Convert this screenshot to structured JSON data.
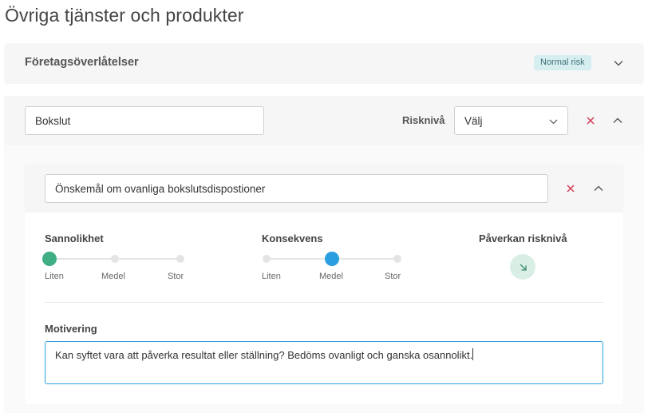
{
  "page": {
    "title": "Övriga tjänster och produkter"
  },
  "collapsed_card": {
    "title": "Företagsöverlåtelser",
    "badge": "Normal risk",
    "chevron_icon": "chevron-down-icon"
  },
  "expanded_card": {
    "name_value": "Bokslut",
    "risk_label": "Risknivå",
    "risk_select": {
      "selected": "Välj"
    },
    "close_icon": "close-icon",
    "chevron_icon": "chevron-up-icon",
    "inner": {
      "name_value": "Önskemål om ovanliga bokslutsdispostioner",
      "likelihood": {
        "label": "Sannolikhet",
        "options": [
          "Liten",
          "Medel",
          "Stor"
        ],
        "selected_index": 0
      },
      "consequence": {
        "label": "Konsekvens",
        "options": [
          "Liten",
          "Medel",
          "Stor"
        ],
        "selected_index": 1
      },
      "impact": {
        "label": "Påverkan risknivå",
        "icon": "arrow-down-right-icon"
      },
      "motivation": {
        "label": "Motivering",
        "value": "Kan syftet vara att påverka resultat eller ställning? Bedöms ovanligt och ganska osannolikt."
      }
    }
  },
  "colors": {
    "accent_blue": "#2a9fe0",
    "accent_green": "#3fae84",
    "close_red": "#d23b55",
    "badge_bg": "#d7eef1"
  }
}
